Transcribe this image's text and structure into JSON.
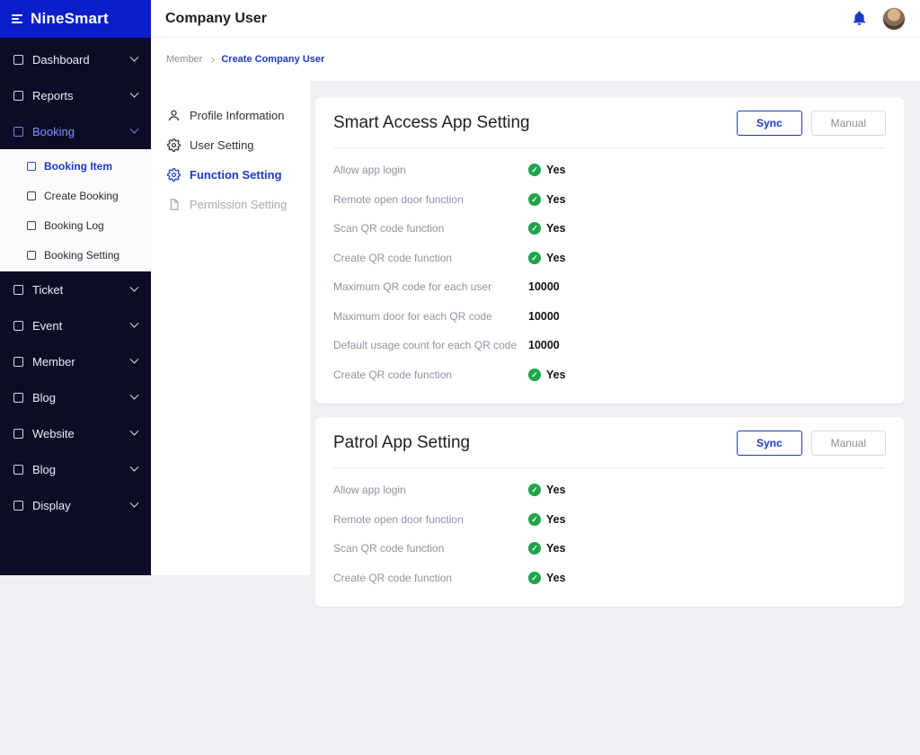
{
  "brand": {
    "name": "NineSmart"
  },
  "header": {
    "title": "Company User"
  },
  "breadcrumb": {
    "items": [
      "Member",
      "Create Company User"
    ]
  },
  "sidebar": {
    "items": [
      {
        "label": "Dashboard"
      },
      {
        "label": "Reports"
      },
      {
        "label": "Booking",
        "expanded": true,
        "active_child": "Booking Item",
        "children": [
          "Booking Item",
          "Create Booking",
          "Booking Log",
          "Booking Setting"
        ]
      },
      {
        "label": "Ticket"
      },
      {
        "label": "Event"
      },
      {
        "label": "Member"
      },
      {
        "label": "Blog"
      },
      {
        "label": "Website"
      },
      {
        "label": "Blog"
      },
      {
        "label": "Display"
      }
    ]
  },
  "subnav": {
    "items": [
      {
        "label": "Profile Information",
        "icon": "person-icon",
        "state": "normal"
      },
      {
        "label": "User Setting",
        "icon": "gear-icon",
        "state": "normal"
      },
      {
        "label": "Function Setting",
        "icon": "gear-icon",
        "state": "active"
      },
      {
        "label": "Permission Setting",
        "icon": "document-icon",
        "state": "muted"
      }
    ]
  },
  "cards": [
    {
      "title": "Smart Access App Setting",
      "buttons": {
        "sync": "Sync",
        "manual": "Manual"
      },
      "rows": [
        {
          "label": "Allow app login",
          "type": "bool",
          "value": "Yes"
        },
        {
          "label": "Remote open door function",
          "type": "bool",
          "value": "Yes"
        },
        {
          "label": "Scan QR code function",
          "type": "bool",
          "value": "Yes"
        },
        {
          "label": "Create QR code function",
          "type": "bool",
          "value": "Yes"
        },
        {
          "label": "Maximum QR code for each user",
          "type": "number",
          "value": "10000"
        },
        {
          "label": "Maximum door for each QR code",
          "type": "number",
          "value": "10000"
        },
        {
          "label": "Default usage count for each QR code",
          "type": "number",
          "value": "10000"
        },
        {
          "label": "Create QR code function",
          "type": "bool",
          "value": "Yes"
        }
      ]
    },
    {
      "title": "Patrol App Setting",
      "buttons": {
        "sync": "Sync",
        "manual": "Manual"
      },
      "rows": [
        {
          "label": "Allow app login",
          "type": "bool",
          "value": "Yes"
        },
        {
          "label": "Remote open door function",
          "type": "bool",
          "value": "Yes"
        },
        {
          "label": "Scan QR code function",
          "type": "bool",
          "value": "Yes"
        },
        {
          "label": "Create QR code function",
          "type": "bool",
          "value": "Yes"
        }
      ]
    }
  ],
  "colors": {
    "accent_blue": "#1d39c4",
    "logo_blue": "#0b1ec9",
    "sidebar_dark": "#0c0c26",
    "success_green": "#1ea44c",
    "content_bg": "#eef0f4"
  }
}
